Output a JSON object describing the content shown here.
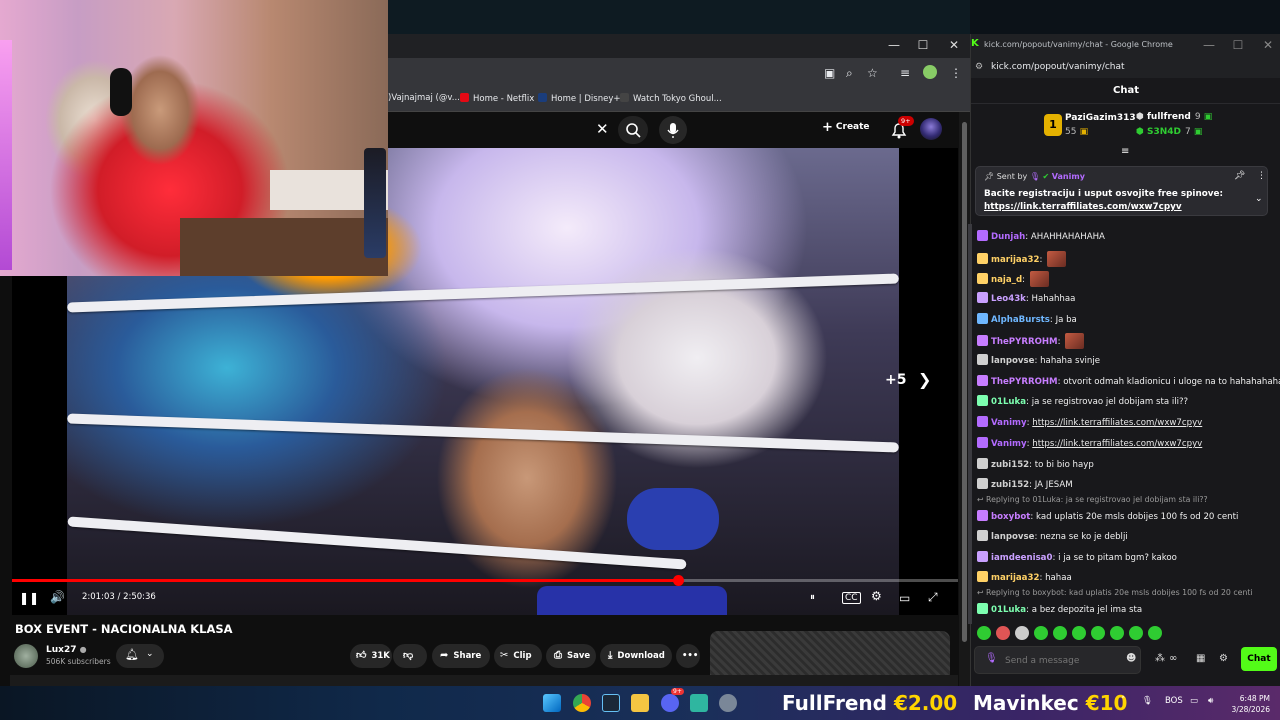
{
  "youtube": {
    "bookmarks": [
      {
        "label": ")Vajnajmaj (@v..."
      },
      {
        "label": "Home - Netflix"
      },
      {
        "label": "Home | Disney+"
      },
      {
        "label": "Watch Tokyo Ghoul..."
      }
    ],
    "create_label": "Create",
    "notif_count": "9+",
    "plus_label": "+5",
    "time_current": "2:01:03",
    "time_total": "2:50:36",
    "progress": 0.705,
    "video_title": "BOX EVENT - NACIONALNA KLASA",
    "channel_name": "Lux27",
    "channel_subs": "506K subscribers",
    "like_count": "31K",
    "share_label": "Share",
    "clip_label": "Clip",
    "save_label": "Save",
    "download_label": "Download"
  },
  "kick": {
    "window_title": "kick.com/popout/vanimy/chat - Google Chrome",
    "url": "kick.com/popout/vanimy/chat",
    "header": "Chat",
    "top_subs": [
      {
        "name": "PaziGazim313",
        "count": "55"
      },
      {
        "name": "fullfrend",
        "count": "9"
      },
      {
        "name": "S3N4D",
        "count": "7"
      }
    ],
    "medal_rank": "1",
    "pinned": {
      "sent_by_label": "Sent by",
      "sender": "Vanimy",
      "message": "Bacite registraciju i usput osvojite free spinove:",
      "link": "https://link.terraffiliates.com/wxw7cpyv"
    },
    "messages": [
      {
        "user": "Dunjah",
        "color": "#b36bff",
        "text": "AHAHHAHAHAHA"
      },
      {
        "user": "marijaa32",
        "color": "#ffd166",
        "text": ""
      },
      {
        "user": "naja_d",
        "color": "#ffd166",
        "text": ""
      },
      {
        "user": "Leo43k",
        "color": "#c9a0ff",
        "text": "Hahahhaa"
      },
      {
        "user": "AlphaBursts",
        "color": "#6fb7ff",
        "text": "Ja ba"
      },
      {
        "user": "ThePYRROHM",
        "color": "#c77dff",
        "text": ""
      },
      {
        "user": "lanpovse",
        "color": "#d0d0d0",
        "text": "hahaha svinje"
      },
      {
        "user": "ThePYRROHM",
        "color": "#c77dff",
        "text": "otvorit odmah kladionicu i uloge na to hahahahaha"
      },
      {
        "user": "01Luka",
        "color": "#7dffb0",
        "text": "ja se registrovao jel dobijam sta ili??"
      },
      {
        "user": "Vanimy",
        "color": "#b36bff",
        "text": "https://link.terraffiliates.com/wxw7cpyv"
      },
      {
        "user": "Vanimy",
        "color": "#b36bff",
        "text": "https://link.terraffiliates.com/wxw7cpyv"
      },
      {
        "user": "zubi152",
        "color": "#d0d0d0",
        "text": "to bi bio hayp"
      },
      {
        "user": "zubi152",
        "color": "#d0d0d0",
        "text": "JA JESAM"
      },
      {
        "reply": "Replying to 01Luka: ja se registrovao jel dobijam sta ili??"
      },
      {
        "user": "boxybot",
        "color": "#c77dff",
        "text": "kad uplatis 20e msls dobijes 100 fs od 20 centi"
      },
      {
        "user": "lanpovse",
        "color": "#d0d0d0",
        "text": "nezna se ko je deblji"
      },
      {
        "user": "iamdeenisa0",
        "color": "#c9a0ff",
        "text": "i ja se to pitam bgm? kakoo"
      },
      {
        "user": "marijaa32",
        "color": "#ffd166",
        "text": "hahaa"
      },
      {
        "reply": "Replying to boxybot: kad uplatis 20e msls dobijes 100 fs od 20 centi"
      },
      {
        "user": "01Luka",
        "color": "#7dffb0",
        "text": "a bez depozita jel ima sta"
      }
    ],
    "input_placeholder": "Send a message",
    "chat_button": "Chat"
  },
  "taskbar": {
    "alert1_name": "FullFrend",
    "alert1_amount": "€2.00",
    "alert2_name": "Mavinkec",
    "alert2_amount": "€10",
    "lang": "BOS",
    "time": "6:48 PM",
    "date": "3/28/2026",
    "discord_badge": "9+"
  }
}
